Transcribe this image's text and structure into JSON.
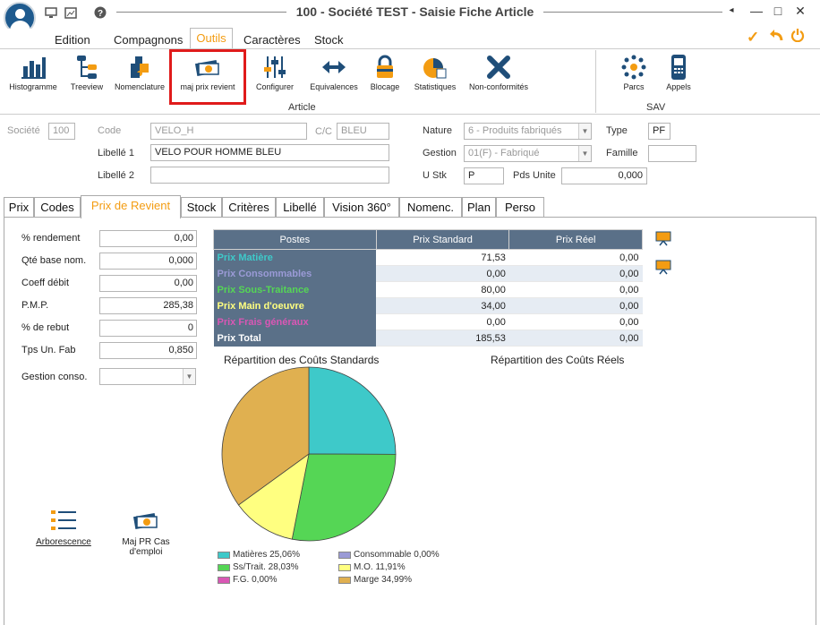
{
  "window": {
    "title": "100 - Société TEST - Saisie Fiche Article",
    "controls": {
      "back": "◂",
      "minimize": "—",
      "maximize": "□",
      "close": "✕"
    }
  },
  "menu": {
    "items": [
      "Edition",
      "Compagnons",
      "Outils",
      "Caractères",
      "Stock"
    ],
    "active": "Outils"
  },
  "ribbon": {
    "buttons": [
      {
        "label": "Histogramme",
        "icon": "bar-chart-icon"
      },
      {
        "label": "Treeview",
        "icon": "treeview-icon"
      },
      {
        "label": "Nomenclature",
        "icon": "puzzle-icon"
      },
      {
        "label": "maj prix revient",
        "icon": "money-icon"
      },
      {
        "label": "Configurer",
        "icon": "sliders-icon"
      },
      {
        "label": "Equivalences",
        "icon": "arrows-icon"
      },
      {
        "label": "Blocage",
        "icon": "lock-icon"
      },
      {
        "label": "Statistiques",
        "icon": "pie-icon"
      },
      {
        "label": "Non-conformités",
        "icon": "x-icon"
      },
      {
        "label": "Parcs",
        "icon": "network-icon"
      },
      {
        "label": "Appels",
        "icon": "phone-icon"
      }
    ],
    "group_article": "Article",
    "group_sav": "SAV",
    "accent": "#f39c12",
    "highlight": "#e01b1b"
  },
  "form": {
    "societe_label": "Société",
    "societe_value": "100",
    "code_label": "Code",
    "code_value": "VELO_H",
    "cc_label": "C/C",
    "cc_value": "BLEU",
    "libelle1_label": "Libellé 1",
    "libelle1_value": "VELO POUR HOMME BLEU",
    "libelle2_label": "Libellé 2",
    "libelle2_value": "",
    "nature_label": "Nature",
    "nature_value": "6 - Produits fabriqués",
    "type_label": "Type",
    "type_value": "PF",
    "gestion_label": "Gestion",
    "gestion_value": "01(F) - Fabriqué",
    "famille_label": "Famille",
    "famille_value": "",
    "ustk_label": "U Stk",
    "ustk_value": "P",
    "pdsunite_label": "Pds Unite",
    "pdsunite_value": "0,000"
  },
  "tabs": [
    "Prix",
    "Codes",
    "Prix de Revient",
    "Stock",
    "Critères",
    "Libellé",
    "Vision 360°",
    "Nomenc.",
    "Plan",
    "Perso"
  ],
  "active_tab": "Prix de Revient",
  "params": [
    {
      "label": "% rendement",
      "value": "0,00"
    },
    {
      "label": "Qté base nom.",
      "value": "0,000"
    },
    {
      "label": "Coeff débit",
      "value": "0,00"
    },
    {
      "label": "P.M.P.",
      "value": "285,38"
    },
    {
      "label": "% de rebut",
      "value": "0"
    },
    {
      "label": "Tps Un. Fab",
      "value": "0,850"
    }
  ],
  "gestion_conso_label": "Gestion conso.",
  "gestion_conso_value": "",
  "cost_table": {
    "headers": [
      "Postes",
      "Prix Standard",
      "Prix Réel"
    ],
    "rows": [
      {
        "name": "Prix Matière",
        "std": "71,53",
        "reel": "0,00",
        "color": "#3ec9c9"
      },
      {
        "name": "Prix Consommables",
        "std": "0,00",
        "reel": "0,00",
        "color": "#9a9ad6"
      },
      {
        "name": "Prix Sous-Traitance",
        "std": "80,00",
        "reel": "0,00",
        "color": "#55d655"
      },
      {
        "name": "Prix Main d'oeuvre",
        "std": "34,00",
        "reel": "0,00",
        "color": "#ffff80"
      },
      {
        "name": "Prix Frais généraux",
        "std": "0,00",
        "reel": "0,00",
        "color": "#d957b5"
      },
      {
        "name": "Prix Total",
        "std": "185,53",
        "reel": "0,00",
        "color": "#ffffff"
      }
    ]
  },
  "chart_std_title": "Répartition des Coûts Standards",
  "chart_reel_title": "Répartition des Coûts Réels",
  "chart_data": {
    "type": "pie",
    "title": "Répartition des Coûts Standards",
    "slices": [
      {
        "label": "Matières",
        "value": 25.06,
        "color": "#3ec9c9"
      },
      {
        "label": "Consommable",
        "value": 0.0,
        "color": "#9a9ad6"
      },
      {
        "label": "Ss/Trait.",
        "value": 28.03,
        "color": "#55d655"
      },
      {
        "label": "M.O.",
        "value": 11.91,
        "color": "#ffff80"
      },
      {
        "label": "F.G.",
        "value": 0.0,
        "color": "#d957b5"
      },
      {
        "label": "Marge",
        "value": 34.99,
        "color": "#e0b050"
      }
    ]
  },
  "legend": [
    {
      "text": "Matières 25,06%",
      "color": "#3ec9c9"
    },
    {
      "text": "Consommable 0,00%",
      "color": "#9a9ad6"
    },
    {
      "text": "Ss/Trait. 28,03%",
      "color": "#55d655"
    },
    {
      "text": "M.O. 11,91%",
      "color": "#ffff80"
    },
    {
      "text": "F.G. 0,00%",
      "color": "#d957b5"
    },
    {
      "text": "Marge 34,99%",
      "color": "#e0b050"
    }
  ],
  "bottom_buttons": {
    "arborescence": "Arborescence",
    "majpr_line1": "Maj PR Cas",
    "majpr_line2": "d'emploi"
  }
}
